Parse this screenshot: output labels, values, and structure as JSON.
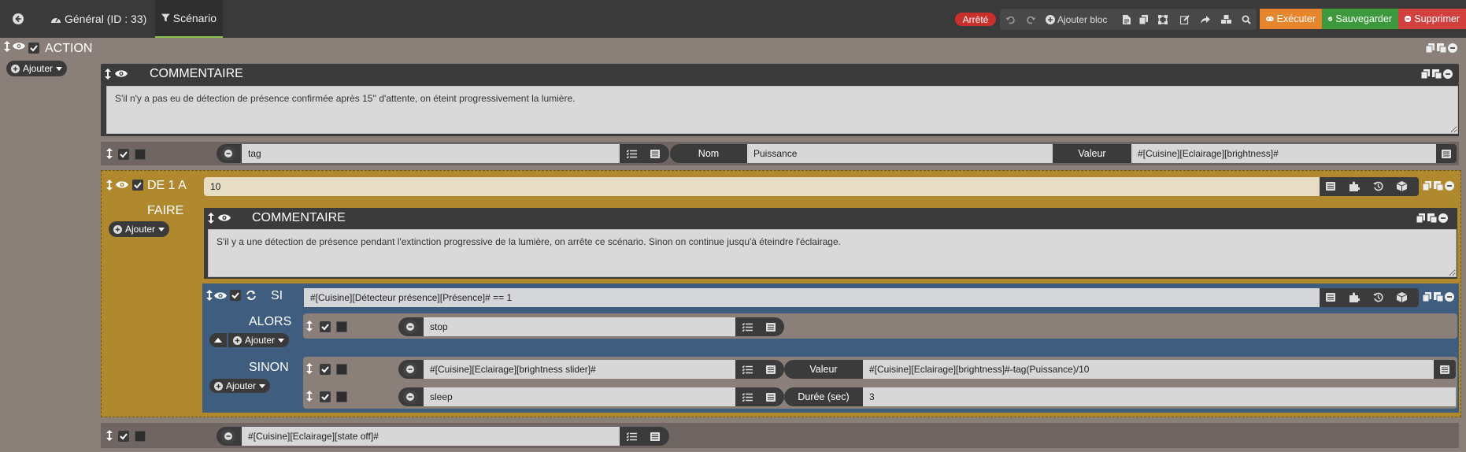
{
  "topbar": {
    "tab_general": "Général (ID : 33)",
    "tab_scenario": "Scénario",
    "status": "Arrêté",
    "add_block": "Ajouter bloc",
    "execute": "Exécuter",
    "save": "Sauvegarder",
    "delete": "Supprimer"
  },
  "action": {
    "title": "ACTION",
    "add": "Ajouter"
  },
  "comment1": {
    "title": "COMMENTAIRE",
    "text": "S'il n'y a pas eu de détection de présence confirmée après 15'' d'attente, on éteint progressivement la lumière."
  },
  "tag_row": {
    "cmd": "tag",
    "name_label": "Nom",
    "name_value": "Puissance",
    "value_label": "Valeur",
    "value": "#[Cuisine][Eclairage][brightness]#"
  },
  "loop": {
    "title": "DE 1 A",
    "count": "10",
    "faire": "FAIRE",
    "add": "Ajouter"
  },
  "comment2": {
    "title": "COMMENTAIRE",
    "text": "S'il y a une détection de présence pendant l'extinction progressive de la lumière, on arrête ce scénario. Sinon on continue jusqu'à éteindre l'éclairage."
  },
  "si": {
    "title": "SI",
    "condition": "#[Cuisine][Détecteur présence][Présence]# == 1",
    "alors": "ALORS",
    "alors_add": "Ajouter",
    "stop": "stop",
    "sinon": "SINON",
    "sinon_add": "Ajouter",
    "slider_cmd": "#[Cuisine][Eclairage][brightness slider]#",
    "slider_label": "Valeur",
    "slider_value": "#[Cuisine][Eclairage][brightness]#-tag(Puissance)/10",
    "sleep_cmd": "sleep",
    "sleep_label": "Durée (sec)",
    "sleep_value": "3"
  },
  "last_row": {
    "cmd": "#[Cuisine][Eclairage][state off]#"
  },
  "colors": {
    "topbar": "#3a3a3a",
    "background": "#8b8079",
    "loop_block": "#b0882d",
    "si_block": "#3f5d7f",
    "execute": "#e6852b",
    "save": "#3c9a3c",
    "delete": "#d24040",
    "status": "#c9302c"
  }
}
